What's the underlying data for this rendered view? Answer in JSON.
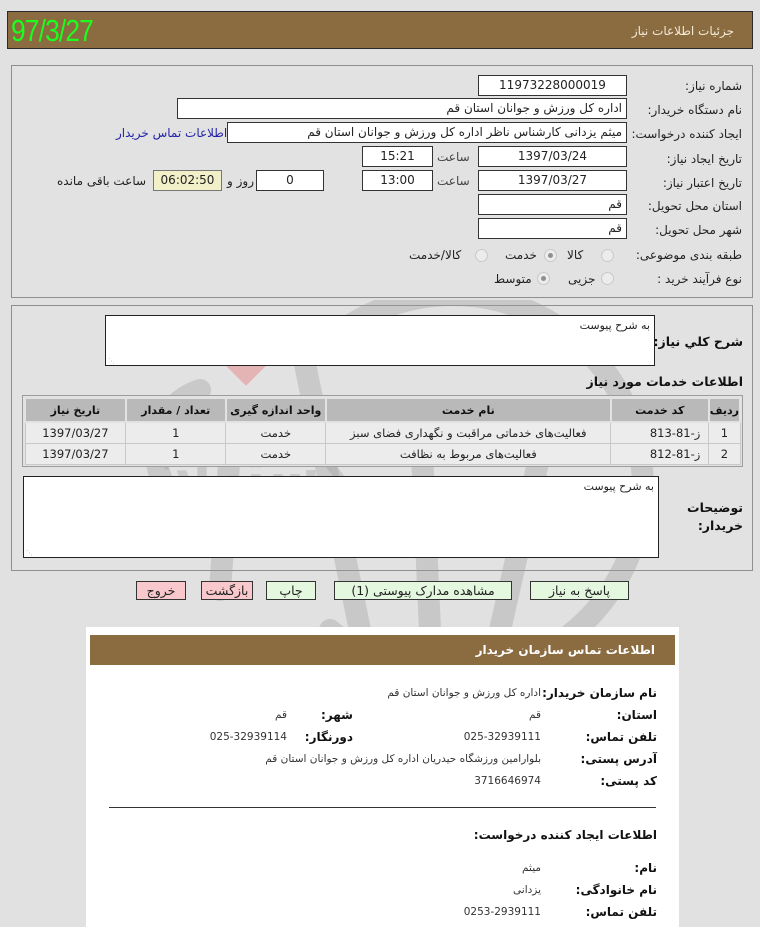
{
  "header": {
    "title": "جزئیات اطلاعات نیاز",
    "date": "97/3/27"
  },
  "form": {
    "need_number": {
      "label": "شماره نیاز:",
      "value": "11973228000019"
    },
    "buyer_org": {
      "label": "نام دستگاه خریدار:",
      "value": "اداره کل ورزش و جوانان استان قم"
    },
    "requester": {
      "label": "ایجاد کننده درخواست:",
      "value": "میثم یزدانی کارشناس ناظر اداره کل ورزش و جوانان استان قم",
      "contact_link": "اطلاعات تماس خریدار"
    },
    "created_date": {
      "label": "تاریخ ایجاد نیاز:",
      "date": "1397/03/24",
      "time_label": "ساعت",
      "time": "15:21"
    },
    "valid_date": {
      "label": "تاریخ اعتبار نیاز:",
      "date": "1397/03/27",
      "time_label": "ساعت",
      "time": "13:00",
      "days": "0",
      "days_label": "روز و",
      "remaining": "06:02:50",
      "remaining_label": "ساعت باقی مانده"
    },
    "delivery_province": {
      "label": "استان محل تحویل:",
      "value": "قم"
    },
    "delivery_city": {
      "label": "شهر محل تحویل:",
      "value": "قم"
    },
    "category": {
      "label": "طبقه بندی موضوعی:",
      "options": [
        "کالا",
        "خدمت",
        "کالا/خدمت"
      ],
      "selected": "خدمت"
    },
    "purchase_type": {
      "label": "نوع فرآیند خرید :",
      "options": [
        "جزیی",
        "متوسط"
      ],
      "selected": "متوسط"
    }
  },
  "description": {
    "label": "شرح کلي نياز:",
    "value": "به شرح پیوست"
  },
  "services": {
    "title": "اطلاعات خدمات مورد نیاز",
    "columns": [
      "ردیف",
      "کد خدمت",
      "نام خدمت",
      "واحد اندازه گیری",
      "تعداد / مقدار",
      "تاریخ نیاز"
    ],
    "rows": [
      {
        "row": "1",
        "code": "ز-81-813",
        "name": "فعالیت‌های خدماتی مراقبت و نگهداری فضای سبز",
        "unit": "خدمت",
        "qty": "1",
        "date": "1397/03/27"
      },
      {
        "row": "2",
        "code": "ز-81-812",
        "name": "فعالیت‌های مربوط به نظافت",
        "unit": "خدمت",
        "qty": "1",
        "date": "1397/03/27"
      }
    ]
  },
  "buyer_notes": {
    "label_line1": "توضیحات",
    "label_line2": "خریدار:",
    "value": "به شرح پیوست"
  },
  "buttons": {
    "reply": "پاسخ به نیاز",
    "attachments": "مشاهده مدارک پیوستی (1)",
    "print": "چاپ",
    "back": "بازگشت",
    "exit": "خروج"
  },
  "contact": {
    "title": "اطلاعات تماس سازمان خریدار",
    "org_label": "نام سازمان خریدار:",
    "org_value": "اداره کل ورزش و جوانان استان قم",
    "province_label": "استان:",
    "province_value": "قم",
    "city_label": "شهر:",
    "city_value": "قم",
    "phone_label": "تلفن تماس:",
    "phone_value": "025-32939111",
    "fax_label": "دورنگار:",
    "fax_value": "025-32939114",
    "address_label": "آدرس پستی:",
    "address_value": "بلوارامین ورزشگاه حیدریان اداره کل ورزش و جوانان استان قم",
    "postal_label": "کد پستی:",
    "postal_value": "3716646974",
    "creator_title": "اطلاعات ایجاد کننده درخواست:",
    "first_name_label": "نام:",
    "first_name_value": "میثم",
    "last_name_label": "نام خانوادگی:",
    "last_name_value": "یزدانی",
    "creator_phone_label": "تلفن تماس:",
    "creator_phone_value": "0253-2939111"
  },
  "colors": {
    "header_bg": "#8b6b40",
    "date_green": "#1dfc1d",
    "button_green": "#e4f8e0",
    "button_pink": "#f8c8cc",
    "remaining_bg": "#f1f0c9"
  }
}
